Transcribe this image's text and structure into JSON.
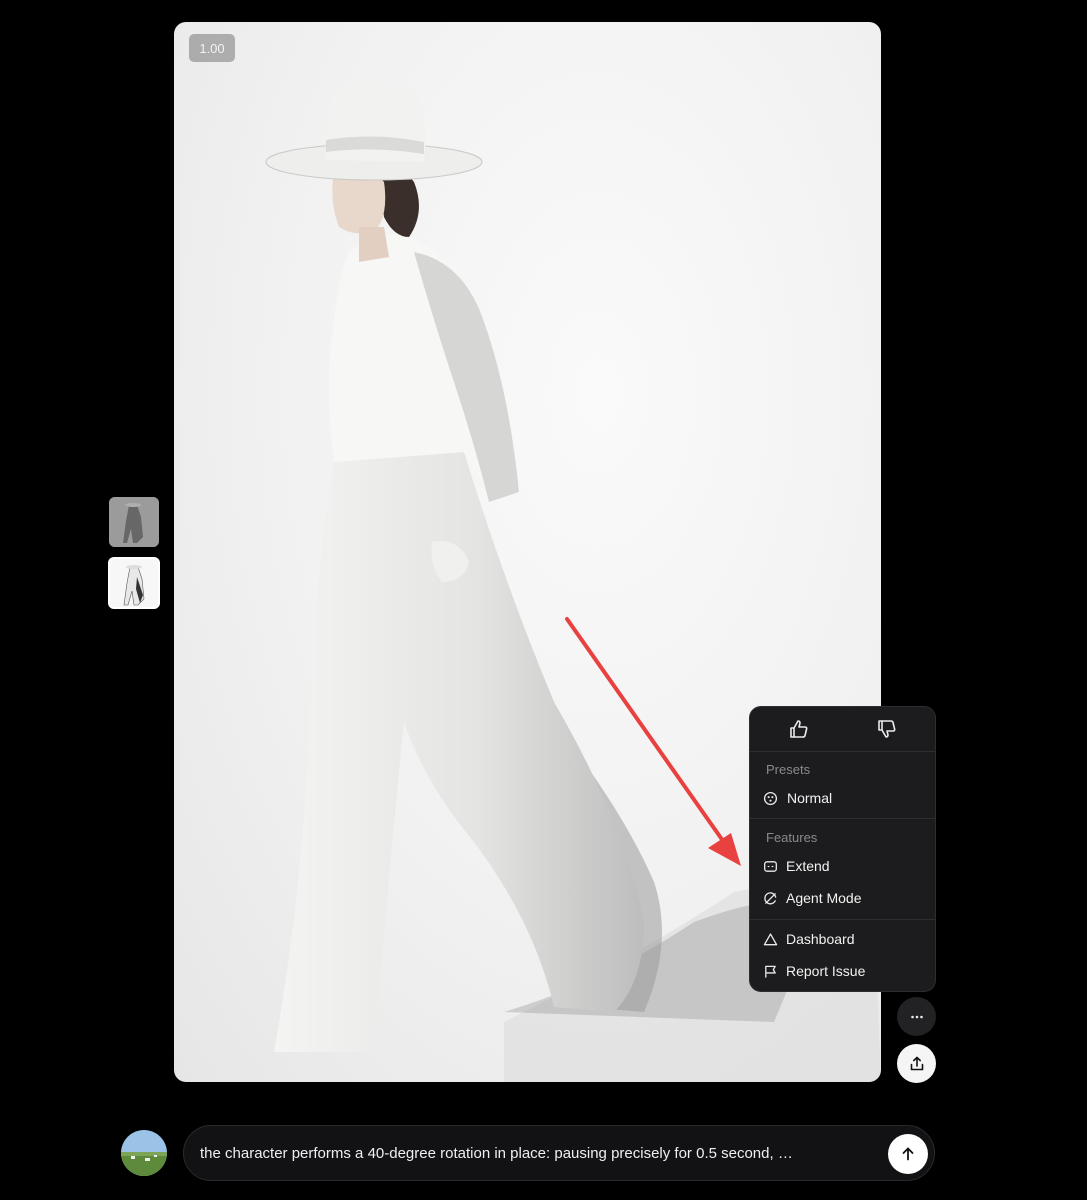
{
  "viewer": {
    "playback_speed": "1.00",
    "image_icon": "fashion-model-photo"
  },
  "thumbnails": [
    {
      "name": "thumbnail-1",
      "icon": "model-thumbnail"
    },
    {
      "name": "thumbnail-2",
      "icon": "model-thumbnail",
      "selected": true
    }
  ],
  "menu": {
    "rating": {
      "up_icon": "thumbs-up-icon",
      "down_icon": "thumbs-down-icon"
    },
    "presets_label": "Presets",
    "presets": [
      {
        "label": "Normal",
        "icon": "preset-icon"
      }
    ],
    "features_label": "Features",
    "features": [
      {
        "label": "Extend",
        "icon": "extend-icon"
      },
      {
        "label": "Agent Mode",
        "icon": "agent-mode-icon"
      }
    ],
    "links": [
      {
        "label": "Dashboard",
        "icon": "triangle-icon"
      },
      {
        "label": "Report Issue",
        "icon": "flag-icon"
      }
    ]
  },
  "actions": {
    "more_icon": "more-horizontal-icon",
    "share_icon": "share-upload-icon"
  },
  "prompt": {
    "text": "the character performs a 40-degree rotation in place: pausing precisely for 0.5 second, …",
    "submit_icon": "arrow-up-icon"
  },
  "colors": {
    "background": "#000000",
    "menu_bg": "#1c1c1e",
    "annotation_arrow": "#e8413f"
  }
}
